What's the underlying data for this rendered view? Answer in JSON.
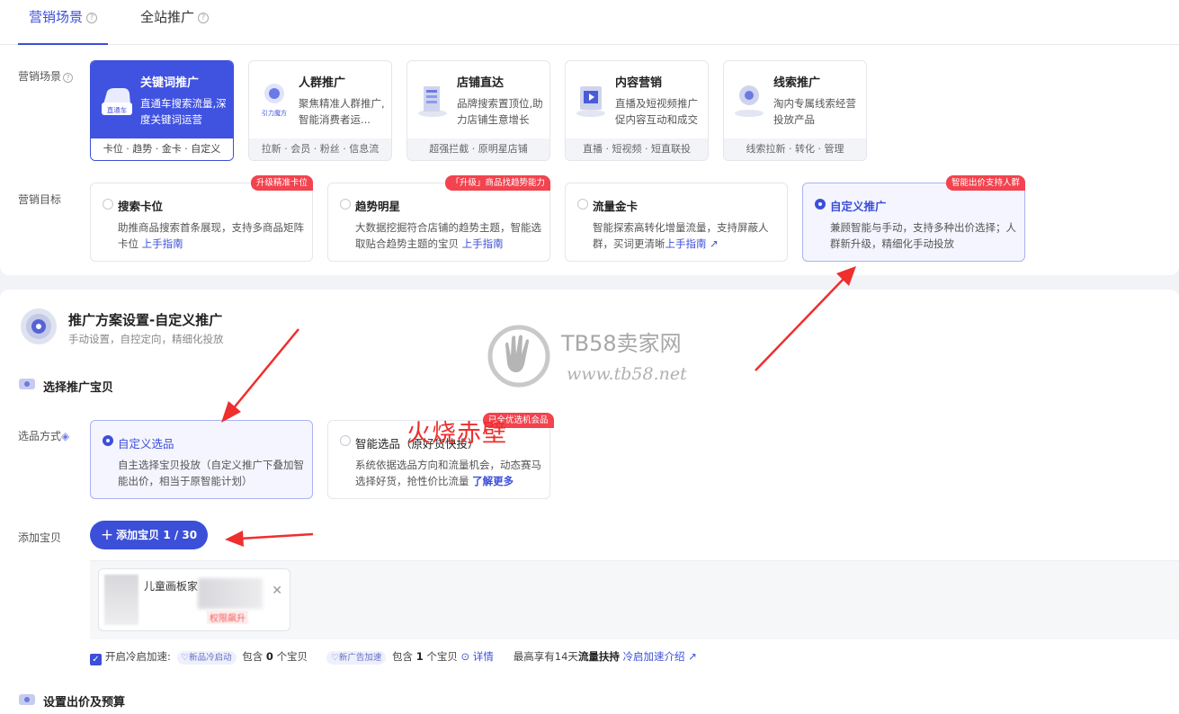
{
  "tabs": [
    {
      "label": "营销场景"
    },
    {
      "label": "全站推广"
    }
  ],
  "labels": {
    "scene": "营销场景",
    "goal": "营销目标",
    "pick_method": "选品方式",
    "add_goods": "添加宝贝"
  },
  "scenes": [
    {
      "title": "关键词推广",
      "desc": "直通车搜索流量,深度关键词运营",
      "foot": "卡位 · 趋势 · 金卡 · 自定义",
      "icon_text": "直通车"
    },
    {
      "title": "人群推广",
      "desc": "聚焦精准人群推广,智能消费者运...",
      "foot": "拉新 · 会员 · 粉丝 · 信息流",
      "icon_text": "引力魔方"
    },
    {
      "title": "店铺直达",
      "desc": "品牌搜索置顶位,助力店铺生意增长",
      "foot": "超强拦截 · 原明星店铺"
    },
    {
      "title": "内容营销",
      "desc": "直播及短视频推广促内容互动和成交",
      "foot": "直播 · 短视频 · 短直联投"
    },
    {
      "title": "线索推广",
      "desc": "淘内专属线索经营投放产品",
      "foot": "线索拉新 · 转化 · 管理"
    }
  ],
  "goals": [
    {
      "title": "搜索卡位",
      "desc": "助推商品搜索首条展现，支持多商品矩阵卡位",
      "link": "上手指南",
      "badge": "升级精准卡位"
    },
    {
      "title": "趋势明星",
      "desc": "大数据挖掘符合店铺的趋势主题，智能选取贴合趋势主题的宝贝",
      "link": "上手指南",
      "badge": "「升级」商品找趋势能力"
    },
    {
      "title": "流量金卡",
      "desc": "智能探索高转化增量流量，支持屏蔽人群，买词更清晰",
      "link": "上手指南"
    },
    {
      "title": "自定义推广",
      "desc": "兼顾智能与手动，支持多种出价选择；人群新升级，精细化手动投放",
      "badge": "智能出价支持人群"
    }
  ],
  "plan": {
    "title": "推广方案设置-自定义推广",
    "subtitle": "手动设置，自控定向，精细化投放"
  },
  "sections": {
    "select_goods": "选择推广宝贝",
    "bid_budget": "设置出价及预算"
  },
  "picks": [
    {
      "title": "自定义选品",
      "desc": "自主选择宝贝投放（自定义推广下叠加智能出价，相当于原智能计划）"
    },
    {
      "title": "智能选品（原好货快投）",
      "desc": "系统依据选品方向和流量机会，动态赛马选择好货，抢性价比流量",
      "link": "了解更多",
      "badge": "已全优选机会品"
    }
  ],
  "add_button": {
    "label": "添加宝贝 1 / 30"
  },
  "goods": {
    "name": "儿童画板家",
    "tag": "权限飙升"
  },
  "cold_start": {
    "label": "开启冷启加速:",
    "pill1": "新品冷启动",
    "text1a": "包含",
    "count1": "0",
    "text1b": "个宝贝",
    "pill2": "新广告加速",
    "text2a": "包含",
    "count2": "1",
    "text2b": "个宝贝",
    "detail": "详情",
    "enjoy_pre": "最高享有14天",
    "enjoy_bold": "流量扶持",
    "intro_link": "冷启加速介绍"
  },
  "watermark": {
    "name": "TB58卖家网",
    "url": "www.tb58.net"
  },
  "handwritten": "火烧赤壁",
  "colors": {
    "accent": "#3b4fd8",
    "badge": "#f2434e",
    "arrow": "#ef2e2e"
  }
}
